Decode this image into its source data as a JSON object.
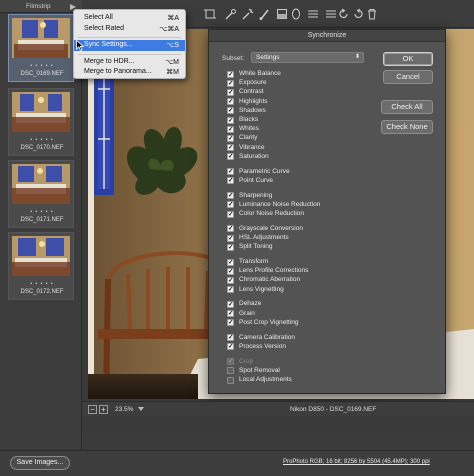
{
  "filmstrip": {
    "title": "Filmstrip",
    "items": [
      {
        "name": "DSC_0169.NEF",
        "rating": "• • • • •",
        "selected": true
      },
      {
        "name": "DSC_0170.NEF",
        "rating": "• • • • •",
        "selected": false
      },
      {
        "name": "DSC_0171.NEF",
        "rating": "• • • • •",
        "selected": false
      },
      {
        "name": "DSC_0172.NEF",
        "rating": "• • • • •",
        "selected": false
      }
    ]
  },
  "menu": {
    "items": [
      {
        "label": "Select All",
        "shortcut": "⌘A",
        "highlighted": false
      },
      {
        "label": "Select Rated",
        "shortcut": "⌥⌘A",
        "highlighted": false
      },
      {
        "label": "Sync Settings...",
        "shortcut": "⌥S",
        "highlighted": true
      },
      {
        "label": "Merge to HDR...",
        "shortcut": "⌥M",
        "highlighted": false
      },
      {
        "label": "Merge to Panorama...",
        "shortcut": "⌘M",
        "highlighted": false
      }
    ]
  },
  "toolbar": {
    "icons": [
      "zoom-icon",
      "hand-icon",
      "white-balance-icon",
      "color-sampler-icon",
      "targeted-adjustment-icon",
      "crop-icon",
      "straighten-icon",
      "transform-icon",
      "spot-removal-icon",
      "red-eye-icon",
      "adjustment-brush-icon",
      "graduated-filter-icon",
      "radial-filter-icon",
      "preferences-icon",
      "rotate-left-icon",
      "rotate-right-icon",
      "trash-icon"
    ]
  },
  "dialog": {
    "title": "Synchronize",
    "subset_label": "Subset:",
    "subset_value": "Settings",
    "ok_label": "OK",
    "cancel_label": "Cancel",
    "check_all_label": "Check All",
    "check_none_label": "Check None",
    "groups": [
      [
        {
          "label": "White Balance",
          "checked": true,
          "disabled": false
        },
        {
          "label": "Exposure",
          "checked": true,
          "disabled": false
        },
        {
          "label": "Contrast",
          "checked": true,
          "disabled": false
        },
        {
          "label": "Highlights",
          "checked": true,
          "disabled": false
        },
        {
          "label": "Shadows",
          "checked": true,
          "disabled": false
        },
        {
          "label": "Blacks",
          "checked": true,
          "disabled": false
        },
        {
          "label": "Whites",
          "checked": true,
          "disabled": false
        },
        {
          "label": "Clarity",
          "checked": true,
          "disabled": false
        },
        {
          "label": "Vibrance",
          "checked": true,
          "disabled": false
        },
        {
          "label": "Saturation",
          "checked": true,
          "disabled": false
        }
      ],
      [
        {
          "label": "Parametric Curve",
          "checked": true,
          "disabled": false
        },
        {
          "label": "Point Curve",
          "checked": true,
          "disabled": false
        }
      ],
      [
        {
          "label": "Sharpening",
          "checked": true,
          "disabled": false
        },
        {
          "label": "Luminance Noise Reduction",
          "checked": true,
          "disabled": false
        },
        {
          "label": "Color Noise Reduction",
          "checked": true,
          "disabled": false
        }
      ],
      [
        {
          "label": "Grayscale Conversion",
          "checked": true,
          "disabled": false
        },
        {
          "label": "HSL Adjustments",
          "checked": true,
          "disabled": false
        },
        {
          "label": "Split Toning",
          "checked": true,
          "disabled": false
        }
      ],
      [
        {
          "label": "Transform",
          "checked": true,
          "disabled": false
        },
        {
          "label": "Lens Profile Corrections",
          "checked": true,
          "disabled": false
        },
        {
          "label": "Chromatic Aberration",
          "checked": true,
          "disabled": false
        },
        {
          "label": "Lens Vignetting",
          "checked": true,
          "disabled": false
        }
      ],
      [
        {
          "label": "Dehaze",
          "checked": true,
          "disabled": false
        },
        {
          "label": "Grain",
          "checked": true,
          "disabled": false
        },
        {
          "label": "Post Crop Vignetting",
          "checked": true,
          "disabled": false
        }
      ],
      [
        {
          "label": "Camera Calibration",
          "checked": true,
          "disabled": false
        },
        {
          "label": "Process Version",
          "checked": true,
          "disabled": false
        }
      ],
      [
        {
          "label": "Crop",
          "checked": true,
          "disabled": true
        },
        {
          "label": "Spot Removal",
          "checked": false,
          "disabled": false
        },
        {
          "label": "Local Adjustments",
          "checked": false,
          "disabled": false
        }
      ]
    ]
  },
  "status": {
    "zoom_value": "23.5%",
    "camera_file": "Nikon D850  -  DSC_0169.NEF",
    "minus_label": "−",
    "plus_label": "+"
  },
  "bottom": {
    "save_label": "Save Images...",
    "workflow_info": "ProPhoto RGB; 16 bit; 8256 by 5504 (45.4MP); 300 ppi"
  }
}
